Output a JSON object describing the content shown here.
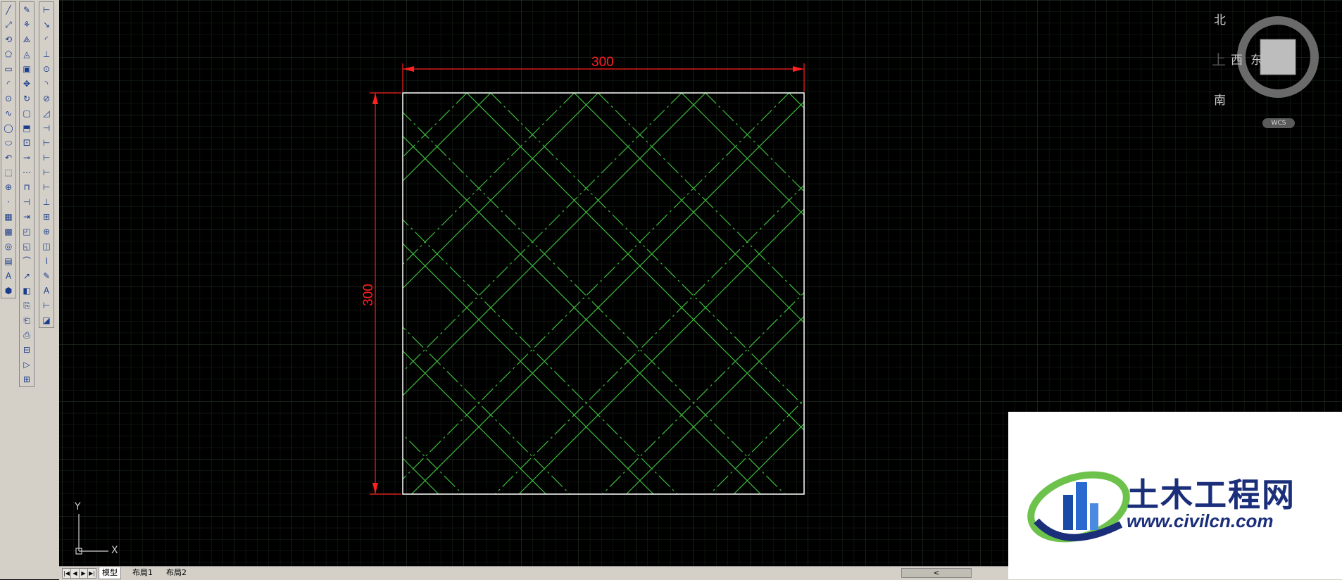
{
  "toolbar": {
    "col1": [
      "╱",
      "⤢",
      "⟲",
      "⬠",
      "▭",
      "◜",
      "⊙",
      "∿",
      "◯",
      "⬭",
      "↶",
      "⬚",
      "⊕",
      "·",
      "▦",
      "▩",
      "◎",
      "▤",
      "A",
      "⬢"
    ],
    "col2": [
      "✎",
      "⚘",
      "⟁",
      "◬",
      "▣",
      "✥",
      "↻",
      "▢",
      "⬒",
      "⚀",
      "⊸",
      "⋯",
      "⊓",
      "⊣",
      "⇥",
      "◰",
      "◱",
      "⌒",
      "↗",
      "◧",
      "⎘",
      "⎗",
      "⎙",
      "⊟",
      "▷",
      "⊞"
    ],
    "col3": [
      "⊢",
      "↘",
      "◜",
      "⊥",
      "⊙",
      "◝",
      "⊘",
      "◿",
      "⊣",
      "⊢",
      "⊢",
      "⊢",
      "⊢",
      "⊥",
      "⊞",
      "⊕",
      "◫",
      "⌇",
      "✎",
      "A",
      "⊢",
      "◪"
    ]
  },
  "drawing": {
    "dim_horizontal": "300",
    "dim_vertical": "300"
  },
  "viewcube": {
    "north": "北",
    "south": "南",
    "east": "东",
    "west": "西",
    "top": "上",
    "wcs": "WCS"
  },
  "ucs": {
    "x_label": "X",
    "y_label": "Y"
  },
  "tabs": {
    "model": "模型",
    "layout1": "布局1",
    "layout2": "布局2",
    "scroll_left": "<"
  },
  "logo": {
    "name": "土木工程网",
    "url": "www.civilcn.com"
  },
  "colors": {
    "dimension": "#ff2020",
    "hatch": "#3dbb3d",
    "border": "#ffffff",
    "grid_minor": "#1a2a1a",
    "grid_major": "#2c3a2c"
  }
}
